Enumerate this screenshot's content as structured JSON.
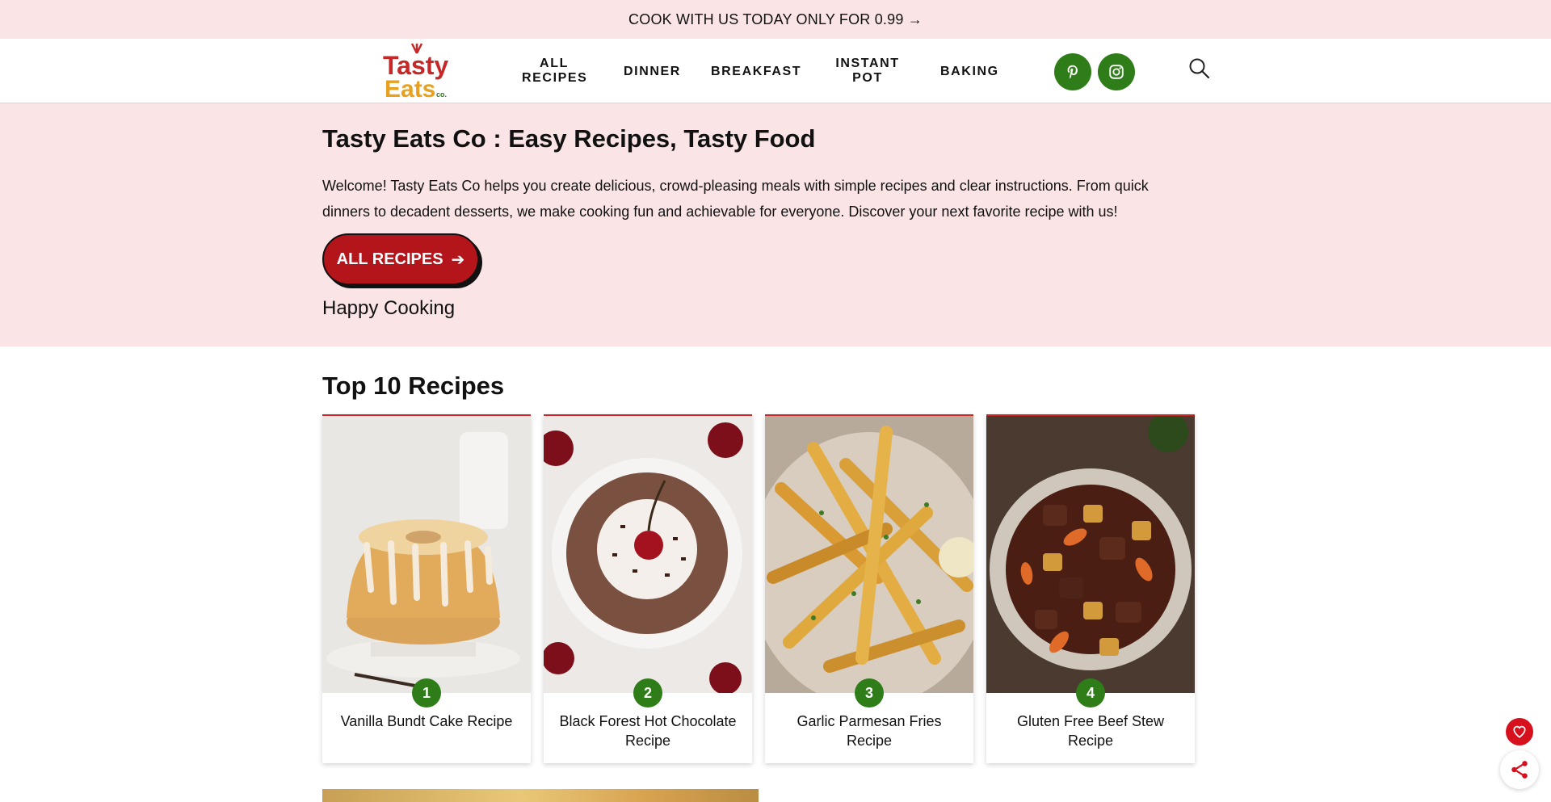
{
  "promo": {
    "text": "COOK WITH US TODAY ONLY FOR 0.99 →"
  },
  "logo": {
    "line1": "Tasty",
    "line2": "Eats",
    "suffix": "co."
  },
  "nav": {
    "items": [
      "ALL RECIPES",
      "DINNER",
      "BREAKFAST",
      "INSTANT POT",
      "BAKING"
    ],
    "all_recipes_1": "ALL",
    "all_recipes_2": "RECIPES",
    "dinner": "DINNER",
    "breakfast": "BREAKFAST",
    "instant_1": "INSTANT",
    "instant_2": "POT",
    "baking": "BAKING"
  },
  "social": {
    "icons": [
      "pinterest-icon",
      "instagram-icon"
    ]
  },
  "hero": {
    "title": "Tasty Eats Co : Easy Recipes, Tasty Food",
    "description": "Welcome! Tasty Eats Co helps you create delicious, crowd-pleasing meals with simple recipes and clear instructions. From quick dinners to decadent desserts, we make cooking fun and achievable for everyone. Discover your next favorite recipe with us!",
    "button_label": "ALL RECIPES",
    "button_arrow": "➔",
    "tagline": "Happy Cooking"
  },
  "top_recipes": {
    "title": "Top 10 Recipes",
    "cards": [
      {
        "rank": "1",
        "title": "Vanilla Bundt Cake Recipe"
      },
      {
        "rank": "2",
        "title": "Black Forest Hot Chocolate Recipe"
      },
      {
        "rank": "3",
        "title": "Garlic Parmesan Fries Recipe"
      },
      {
        "rank": "4",
        "title": "Gluten Free Beef Stew Recipe"
      }
    ]
  },
  "colors": {
    "accent_green": "#2e7d18",
    "accent_red": "#b3151b",
    "hero_pink": "#fbe4e6"
  }
}
